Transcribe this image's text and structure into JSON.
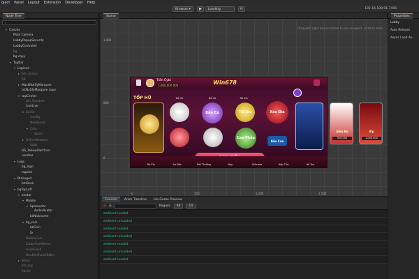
{
  "menu": [
    "oject",
    "Panel",
    "Layout",
    "Extension",
    "Developer",
    "Help"
  ],
  "toolbar": {
    "browser": "Browser ▾",
    "loading": "Loading",
    "ip": "192.16.108.91.7456"
  },
  "hierarchy": {
    "title": "Node Tree",
    "search_placeholder": "",
    "nodes": [
      {
        "label": "Canvas",
        "level": 0,
        "arrow": "▾",
        "dim": false
      },
      {
        "label": "Main Camera",
        "level": 1,
        "arrow": "",
        "dim": false
      },
      {
        "label": "LobbyPopupSecurity",
        "level": 1,
        "arrow": "",
        "dim": false
      },
      {
        "label": "LobbyController",
        "level": 1,
        "arrow": "",
        "dim": false
      },
      {
        "label": "bg",
        "level": 1,
        "arrow": "",
        "dim": true
      },
      {
        "label": "bg copy",
        "level": 1,
        "arrow": "",
        "dim": false
      },
      {
        "label": "TopBar",
        "level": 1,
        "arrow": "▾",
        "dim": false
      },
      {
        "label": "Logined",
        "level": 2,
        "arrow": "▾",
        "dim": false
      },
      {
        "label": "btn_avatar",
        "level": 3,
        "arrow": "▸",
        "dim": true
      },
      {
        "label": "bg",
        "level": 3,
        "arrow": "",
        "dim": true
      },
      {
        "label": "MaskNotifyMarquee",
        "level": 3,
        "arrow": "▸",
        "dim": false
      },
      {
        "label": "txtNotifyMarquee copy",
        "level": 3,
        "arrow": "",
        "dim": false
      },
      {
        "label": "topCenter",
        "level": 3,
        "arrow": "▾",
        "dim": false
      },
      {
        "label": "btn_Random",
        "level": 4,
        "arrow": "",
        "dim": true
      },
      {
        "label": "iconLive",
        "level": 4,
        "arrow": "",
        "dim": false
      },
      {
        "label": "Sprite",
        "level": 4,
        "arrow": "▾",
        "dim": true
      },
      {
        "label": "iconBg",
        "level": 5,
        "arrow": "",
        "dim": true
      },
      {
        "label": "NewSprite",
        "level": 5,
        "arrow": "",
        "dim": true
      },
      {
        "label": "Coin",
        "level": 5,
        "arrow": "▾",
        "dim": true
      },
      {
        "label": "Sprite",
        "level": 6,
        "arrow": "",
        "dim": true
      },
      {
        "label": "OnlineNetwork",
        "level": 4,
        "arrow": "▸",
        "dim": true
      },
      {
        "label": "label",
        "level": 5,
        "arrow": "",
        "dim": true
      },
      {
        "label": "BG_YellowAlertIcon",
        "level": 3,
        "arrow": "",
        "dim": false
      },
      {
        "label": "userbar",
        "level": 3,
        "arrow": "",
        "dim": false
      },
      {
        "label": "Logo",
        "level": 2,
        "arrow": "▾",
        "dim": false
      },
      {
        "label": "bg_logo",
        "level": 3,
        "arrow": "",
        "dim": false
      },
      {
        "label": "logoAd",
        "level": 3,
        "arrow": "",
        "dim": false
      },
      {
        "label": "BtnLoged",
        "level": 2,
        "arrow": "▾",
        "dim": false
      },
      {
        "label": "btnBack",
        "level": 3,
        "arrow": "",
        "dim": false
      },
      {
        "label": "bgTopLeft",
        "level": 2,
        "arrow": "▾",
        "dim": false
      },
      {
        "label": "avatar",
        "level": 3,
        "arrow": "▾",
        "dim": false
      },
      {
        "label": "Mobile",
        "level": 4,
        "arrow": "▾",
        "dim": false
      },
      {
        "label": "Sprmavtar",
        "level": 5,
        "arrow": "▾",
        "dim": false
      },
      {
        "label": "AvderAvatar",
        "level": 6,
        "arrow": "",
        "dim": false
      },
      {
        "label": "LbNickname",
        "level": 5,
        "arrow": "",
        "dim": false
      },
      {
        "label": "bg_coin",
        "level": 4,
        "arrow": "▾",
        "dim": false
      },
      {
        "label": "LbCoin",
        "level": 5,
        "arrow": "",
        "dim": false
      },
      {
        "label": "lb",
        "level": 5,
        "arrow": "",
        "dim": false
      },
      {
        "label": "MobileCoin",
        "level": 4,
        "arrow": "",
        "dim": true
      },
      {
        "label": "LobbyPushHome",
        "level": 4,
        "arrow": "",
        "dim": true
      },
      {
        "label": "AnimFlash",
        "level": 4,
        "arrow": "",
        "dim": true
      },
      {
        "label": "DouBleShow2BtBin",
        "level": 4,
        "arrow": "",
        "dim": true
      },
      {
        "label": "Blank",
        "level": 3,
        "arrow": "▸",
        "dim": true
      },
      {
        "label": "btn_top",
        "level": 3,
        "arrow": "",
        "dim": true
      },
      {
        "label": "Sprite",
        "level": 3,
        "arrow": "",
        "dim": true
      }
    ]
  },
  "scene": {
    "tab": "Scene",
    "hint": "Drag with right mouse button to pan viewport, scroll to zoom.",
    "ruler_left": [
      "1,000",
      "500",
      "0"
    ],
    "ruler_bottom": [
      "0",
      "500",
      "1,000",
      "1,500"
    ],
    "game": {
      "player_name": "Trần Cybi",
      "balance": "1,000,000,000",
      "logo": "Win678",
      "jackpot": "TỐP HŨ",
      "labels_top": [
        "Nổ Hũ",
        "Nổ Hũ",
        "Tài Xỉu"
      ],
      "games": [
        "Sâm",
        "Bắn Cá",
        "Tài Xỉu",
        "Xóc Đĩa",
        "Bầu Cua",
        "Cao Thấp"
      ],
      "withdraw": "RÚT TIỀN",
      "bottom_labels": [
        "Tài Xỉu",
        "Sự Kiện",
        "Đổi Thưởng",
        "Nạp",
        "Giftcode",
        "Hộp Thư",
        "Hỗ Trợ"
      ],
      "side_values": [
        "500,000",
        "1,000,000"
      ],
      "side_titles": [
        "Siêu Hũ",
        "Vip"
      ]
    }
  },
  "properties": {
    "title": "Properties",
    "rows": [
      "Lobby",
      "Auto Release",
      "Async Load As..."
    ]
  },
  "console": {
    "tabs": [
      "Console",
      "Anim Timeline",
      "Ide Game Preview"
    ],
    "region_label": "Region:",
    "region_value": "All",
    "level_value": "14",
    "logs": [
      "ambient loaded",
      "ambient unloaded",
      "ambient loaded",
      "ambient unloaded",
      "ambient loaded",
      "ambient unloaded",
      "ambient loaded"
    ]
  }
}
